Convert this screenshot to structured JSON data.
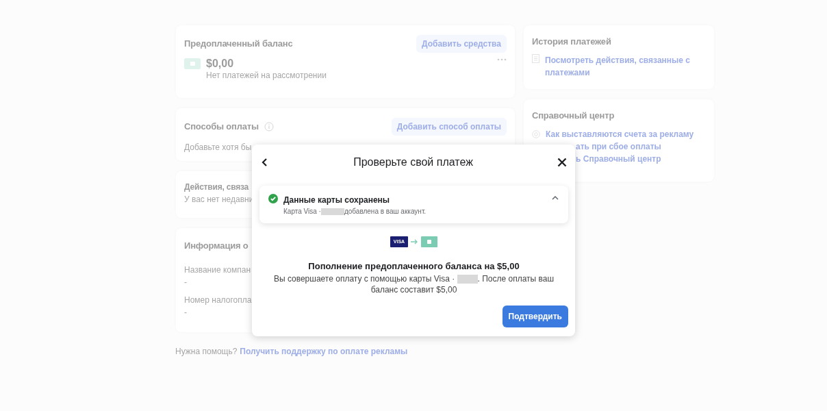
{
  "balance_card": {
    "title": "Предоплаченный баланс",
    "action": "Добавить средства",
    "amount": "$0,00",
    "note": "Нет платежей на рассмотрении"
  },
  "payment_methods_card": {
    "title": "Способы оплаты",
    "action": "Добавить способ оплаты",
    "note": "Добавьте хотя бы"
  },
  "activity_card": {
    "title": "Действия, связа",
    "note": "У вас нет недавни"
  },
  "business_info_card": {
    "title": "Информация о",
    "fields": [
      {
        "label": "Название компан",
        "value": "-"
      },
      {
        "label": "Номер налогопла",
        "value": "-"
      }
    ]
  },
  "help_line": {
    "text": "Нужна помощь?",
    "link": "Получить поддержку по оплате рекламы"
  },
  "payment_history_card": {
    "title": "История платежей",
    "link": "Посмотреть действия, связанные с платежами"
  },
  "help_center_card": {
    "title": "Справочный центр",
    "links": [
      "Как выставляются счета за рекламу",
      "ать при сбое оплаты",
      "ь Справочный центр"
    ]
  },
  "dialog": {
    "title": "Проверьте свой платеж",
    "notice": {
      "title": "Данные карты сохранены",
      "text_before": "Карта Visa ·",
      "text_after": "добавлена в ваш аккаунт.",
      "expanded": true
    },
    "card_brand": "VISA",
    "summary_title": "Пополнение предоплаченного баланса на $5,00",
    "summary_before": "Вы совершаете оплату с помощью карты Visa ·",
    "summary_after": ". После оплаты ваш баланс составит $5,00",
    "confirm_button": "Подтвердить"
  }
}
